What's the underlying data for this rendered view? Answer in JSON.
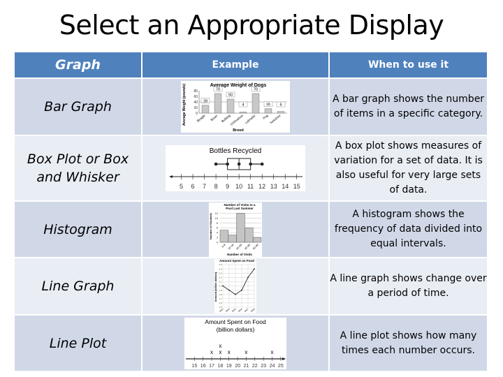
{
  "title": "Select an Appropriate Display",
  "table": {
    "headers": {
      "graph": "Graph",
      "example": "Example",
      "when": "When to use it"
    },
    "rows": [
      {
        "name": "Bar Graph",
        "description": "A bar graph shows the number of items in a specific category."
      },
      {
        "name": "Box Plot or Box and Whisker",
        "description": "A box plot shows measures of variation for a set of data. It is also useful for very large sets of data."
      },
      {
        "name": "Histogram",
        "description": "A histogram shows the frequency of data divided into equal intervals."
      },
      {
        "name": "Line Graph",
        "description": "A line graph shows change over a period of time."
      },
      {
        "name": "Line Plot",
        "description": "A line plot shows how many times each number occurs."
      }
    ]
  },
  "colors": {
    "header": "#4f81bd",
    "row_dark": "#d0d8e8",
    "row_light": "#e9edf4"
  },
  "chart_data": [
    {
      "type": "bar",
      "title": "Average Weight of Dogs",
      "xlabel": "Breed",
      "ylabel": "Average Weight (pounds)",
      "categories": [
        "Beagle",
        "Boxer",
        "Bulldog",
        "Chihuahua",
        "Labrador",
        "Pug",
        "Yorkshire"
      ],
      "values": [
        28,
        70,
        50,
        4,
        70,
        16,
        6
      ],
      "data_labels": [
        "28",
        "70",
        "50",
        "4",
        "70",
        "16",
        "6"
      ],
      "yticks": [
        "0",
        "20",
        "40",
        "60",
        "80"
      ],
      "ylim": [
        0,
        80
      ],
      "reference_line": 40
    },
    {
      "type": "box",
      "title": "Bottles Recycled",
      "min": 8,
      "q1": 9,
      "median": 10,
      "q3": 11,
      "max": 12,
      "xticks": [
        "5",
        "6",
        "7",
        "8",
        "9",
        "10",
        "11",
        "12",
        "13",
        "14",
        "15"
      ],
      "xlim": [
        4,
        15.5
      ]
    },
    {
      "type": "bar",
      "title": "Number of Visits to a Pool Last Summer",
      "xlabel": "Number of Visits",
      "ylabel": "Number of Students",
      "categories": [
        "0-9",
        "10-19",
        "20-29",
        "30-39",
        "40-49"
      ],
      "values": [
        5,
        3,
        12,
        6,
        2
      ],
      "yticks": [
        "0",
        "2",
        "4",
        "6",
        "8",
        "10",
        "12"
      ],
      "ylim": [
        0,
        13
      ]
    },
    {
      "type": "line",
      "title": "Amount Spent on Food",
      "ylabel": "Amount (billion dollars)",
      "x": [
        "2003",
        "2004",
        "2005",
        "2006",
        "2007",
        "2008"
      ],
      "values": [
        2.0,
        1.9,
        1.8,
        1.9,
        2.2,
        2.4
      ],
      "yticks": [
        "1.5",
        "1.6",
        "1.7",
        "1.8",
        "1.9",
        "2.0",
        "2.1",
        "2.2",
        "2.3",
        "2.4",
        "2.5"
      ],
      "ylim": [
        1.5,
        2.5
      ]
    },
    {
      "type": "scatter",
      "title": "Amount Spent on Food",
      "subtitle": "(billion dollars)",
      "marker": "X",
      "counts": {
        "17": 1,
        "18": 2,
        "19": 1,
        "21": 1,
        "24": 1
      },
      "xticks": [
        "15",
        "16",
        "17",
        "18",
        "19",
        "20",
        "21",
        "22",
        "23",
        "24",
        "25"
      ],
      "xlim": [
        14,
        25.5
      ]
    }
  ]
}
